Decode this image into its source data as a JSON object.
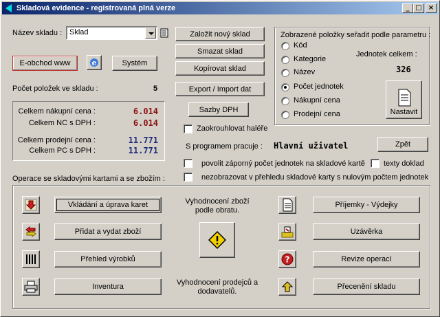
{
  "window": {
    "title": "Skladová evidence - registrovaná plná verze",
    "min": "_",
    "max": "□",
    "close": "×"
  },
  "store": {
    "label": "Název skladu :",
    "value": "Sklad"
  },
  "buttons": {
    "new_store": "Založit nový sklad",
    "delete_store": "Smazat sklad",
    "copy_store": "Kopírovat sklad",
    "export_import": "Export / Import dat",
    "vat_rates": "Sazby DPH",
    "eshop": "E-obchod www",
    "system": "Systém",
    "back": "Zpět",
    "set": "Nastavit",
    "entry_edit": "Vkládání a úprava karet",
    "add_issue": "Přidat a vydat zboží",
    "product_overview": "Přehled výrobků",
    "inventory": "Inventura",
    "receipts_issues": "Příjemky - Výdejky",
    "closing": "Uzávěrka",
    "op_review": "Revize operací",
    "revaluation": "Přecenění skladu"
  },
  "stats": {
    "items_label": "Počet položek ve skladu :",
    "items_value": "5",
    "purchase_label": "Celkem nákupní cena :",
    "purchase_value": "6.014",
    "purchase_vat_label": "Celkem NC s DPH :",
    "purchase_vat_value": "6.014",
    "sale_label": "Celkem prodejní cena :",
    "sale_value": "11.771",
    "sale_vat_label": "Celkem PC s DPH :",
    "sale_vat_value": "11.771"
  },
  "sort": {
    "title": "Zobrazené položky seřadit podle parametru :",
    "options": [
      "Kód",
      "Kategorie",
      "Název",
      "Počet jednotek",
      "Nákupní cena",
      "Prodejní cena"
    ],
    "selected": "Počet jednotek",
    "units_label": "Jednotek celkem :",
    "units_value": "326"
  },
  "options": {
    "round_label": "Zaokrouhlovat haléře",
    "user_label": "S programem pracuje :",
    "user_value": "Hlavní uživatel",
    "negative_label": "povolit záporný počet jednotek na skladové kartě",
    "texts_label": "texty doklad",
    "hide_zero_label": "nezobrazovat v přehledu skladové karty s nulovým počtem jednotek"
  },
  "ops": {
    "title": "Operace se skladovými kartami a se zbožím :",
    "eval_goods": "Vyhodnocení zboží podle obratu.",
    "eval_sales": "Vyhodnocení prodejců a dodavatelů."
  },
  "colors": {
    "value_red": "#8b1010",
    "value_navy": "#1a2a7a",
    "title_start": "#0a246a",
    "title_end": "#a6caf0"
  }
}
